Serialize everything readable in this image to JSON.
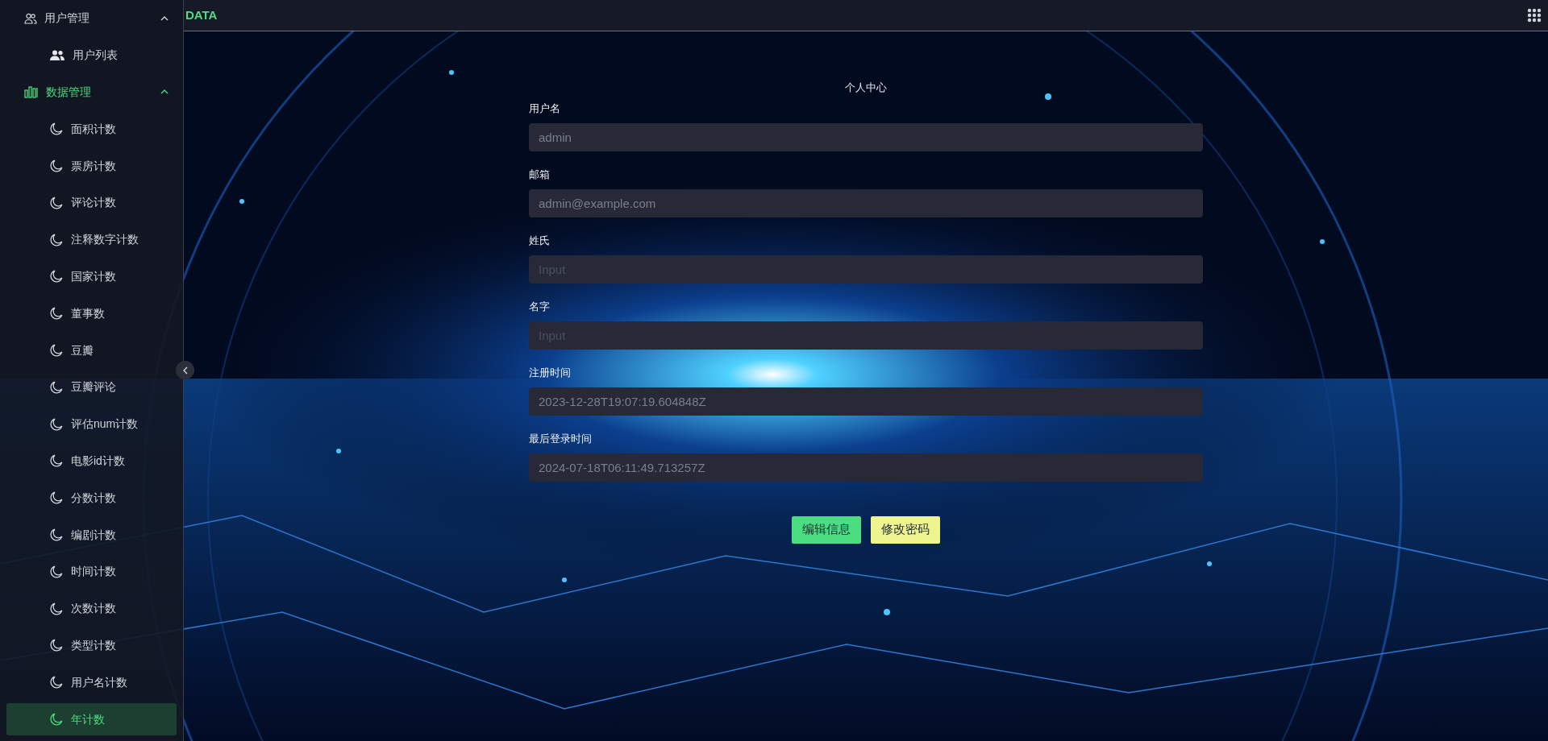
{
  "topbar": {
    "brand": "DATA"
  },
  "sidebar": {
    "groups": [
      {
        "label": "用户管理",
        "expanded": true,
        "active": false,
        "children": [
          {
            "label": "用户列表",
            "selected": false
          }
        ]
      },
      {
        "label": "数据管理",
        "expanded": true,
        "active": true,
        "children": [
          {
            "label": "面积计数",
            "selected": false
          },
          {
            "label": "票房计数",
            "selected": false
          },
          {
            "label": "评论计数",
            "selected": false
          },
          {
            "label": "注释数字计数",
            "selected": false
          },
          {
            "label": "国家计数",
            "selected": false
          },
          {
            "label": "董事数",
            "selected": false
          },
          {
            "label": "豆瓣",
            "selected": false
          },
          {
            "label": "豆瓣评论",
            "selected": false
          },
          {
            "label": "评估num计数",
            "selected": false
          },
          {
            "label": "电影id计数",
            "selected": false
          },
          {
            "label": "分数计数",
            "selected": false
          },
          {
            "label": "编剧计数",
            "selected": false
          },
          {
            "label": "时间计数",
            "selected": false
          },
          {
            "label": "次数计数",
            "selected": false
          },
          {
            "label": "类型计数",
            "selected": false
          },
          {
            "label": "用户名计数",
            "selected": false
          },
          {
            "label": "年计数",
            "selected": true
          }
        ]
      }
    ]
  },
  "profile": {
    "title": "个人中心",
    "fields": [
      {
        "label": "用户名",
        "value": "admin"
      },
      {
        "label": "邮箱",
        "value": "admin@example.com"
      },
      {
        "label": "姓氏",
        "placeholder": "Input"
      },
      {
        "label": "名字",
        "placeholder": "Input"
      },
      {
        "label": "注册时间",
        "value": "2023-12-28T19:07:19.604848Z"
      },
      {
        "label": "最后登录时间",
        "value": "2024-07-18T06:11:49.713257Z"
      }
    ],
    "buttons": [
      {
        "label": "编辑信息",
        "kind": "edit"
      },
      {
        "label": "修改密码",
        "kind": "password"
      }
    ]
  }
}
